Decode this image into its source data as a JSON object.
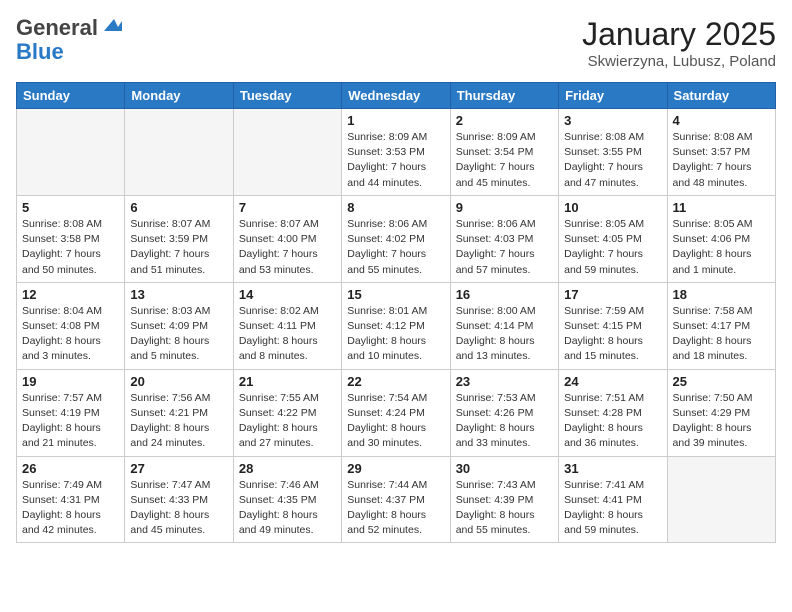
{
  "header": {
    "logo_general": "General",
    "logo_blue": "Blue",
    "title": "January 2025",
    "subtitle": "Skwierzyna, Lubusz, Poland"
  },
  "days_of_week": [
    "Sunday",
    "Monday",
    "Tuesday",
    "Wednesday",
    "Thursday",
    "Friday",
    "Saturday"
  ],
  "weeks": [
    [
      {
        "day": "",
        "info": ""
      },
      {
        "day": "",
        "info": ""
      },
      {
        "day": "",
        "info": ""
      },
      {
        "day": "1",
        "info": "Sunrise: 8:09 AM\nSunset: 3:53 PM\nDaylight: 7 hours and 44 minutes."
      },
      {
        "day": "2",
        "info": "Sunrise: 8:09 AM\nSunset: 3:54 PM\nDaylight: 7 hours and 45 minutes."
      },
      {
        "day": "3",
        "info": "Sunrise: 8:08 AM\nSunset: 3:55 PM\nDaylight: 7 hours and 47 minutes."
      },
      {
        "day": "4",
        "info": "Sunrise: 8:08 AM\nSunset: 3:57 PM\nDaylight: 7 hours and 48 minutes."
      }
    ],
    [
      {
        "day": "5",
        "info": "Sunrise: 8:08 AM\nSunset: 3:58 PM\nDaylight: 7 hours and 50 minutes."
      },
      {
        "day": "6",
        "info": "Sunrise: 8:07 AM\nSunset: 3:59 PM\nDaylight: 7 hours and 51 minutes."
      },
      {
        "day": "7",
        "info": "Sunrise: 8:07 AM\nSunset: 4:00 PM\nDaylight: 7 hours and 53 minutes."
      },
      {
        "day": "8",
        "info": "Sunrise: 8:06 AM\nSunset: 4:02 PM\nDaylight: 7 hours and 55 minutes."
      },
      {
        "day": "9",
        "info": "Sunrise: 8:06 AM\nSunset: 4:03 PM\nDaylight: 7 hours and 57 minutes."
      },
      {
        "day": "10",
        "info": "Sunrise: 8:05 AM\nSunset: 4:05 PM\nDaylight: 7 hours and 59 minutes."
      },
      {
        "day": "11",
        "info": "Sunrise: 8:05 AM\nSunset: 4:06 PM\nDaylight: 8 hours and 1 minute."
      }
    ],
    [
      {
        "day": "12",
        "info": "Sunrise: 8:04 AM\nSunset: 4:08 PM\nDaylight: 8 hours and 3 minutes."
      },
      {
        "day": "13",
        "info": "Sunrise: 8:03 AM\nSunset: 4:09 PM\nDaylight: 8 hours and 5 minutes."
      },
      {
        "day": "14",
        "info": "Sunrise: 8:02 AM\nSunset: 4:11 PM\nDaylight: 8 hours and 8 minutes."
      },
      {
        "day": "15",
        "info": "Sunrise: 8:01 AM\nSunset: 4:12 PM\nDaylight: 8 hours and 10 minutes."
      },
      {
        "day": "16",
        "info": "Sunrise: 8:00 AM\nSunset: 4:14 PM\nDaylight: 8 hours and 13 minutes."
      },
      {
        "day": "17",
        "info": "Sunrise: 7:59 AM\nSunset: 4:15 PM\nDaylight: 8 hours and 15 minutes."
      },
      {
        "day": "18",
        "info": "Sunrise: 7:58 AM\nSunset: 4:17 PM\nDaylight: 8 hours and 18 minutes."
      }
    ],
    [
      {
        "day": "19",
        "info": "Sunrise: 7:57 AM\nSunset: 4:19 PM\nDaylight: 8 hours and 21 minutes."
      },
      {
        "day": "20",
        "info": "Sunrise: 7:56 AM\nSunset: 4:21 PM\nDaylight: 8 hours and 24 minutes."
      },
      {
        "day": "21",
        "info": "Sunrise: 7:55 AM\nSunset: 4:22 PM\nDaylight: 8 hours and 27 minutes."
      },
      {
        "day": "22",
        "info": "Sunrise: 7:54 AM\nSunset: 4:24 PM\nDaylight: 8 hours and 30 minutes."
      },
      {
        "day": "23",
        "info": "Sunrise: 7:53 AM\nSunset: 4:26 PM\nDaylight: 8 hours and 33 minutes."
      },
      {
        "day": "24",
        "info": "Sunrise: 7:51 AM\nSunset: 4:28 PM\nDaylight: 8 hours and 36 minutes."
      },
      {
        "day": "25",
        "info": "Sunrise: 7:50 AM\nSunset: 4:29 PM\nDaylight: 8 hours and 39 minutes."
      }
    ],
    [
      {
        "day": "26",
        "info": "Sunrise: 7:49 AM\nSunset: 4:31 PM\nDaylight: 8 hours and 42 minutes."
      },
      {
        "day": "27",
        "info": "Sunrise: 7:47 AM\nSunset: 4:33 PM\nDaylight: 8 hours and 45 minutes."
      },
      {
        "day": "28",
        "info": "Sunrise: 7:46 AM\nSunset: 4:35 PM\nDaylight: 8 hours and 49 minutes."
      },
      {
        "day": "29",
        "info": "Sunrise: 7:44 AM\nSunset: 4:37 PM\nDaylight: 8 hours and 52 minutes."
      },
      {
        "day": "30",
        "info": "Sunrise: 7:43 AM\nSunset: 4:39 PM\nDaylight: 8 hours and 55 minutes."
      },
      {
        "day": "31",
        "info": "Sunrise: 7:41 AM\nSunset: 4:41 PM\nDaylight: 8 hours and 59 minutes."
      },
      {
        "day": "",
        "info": ""
      }
    ]
  ]
}
